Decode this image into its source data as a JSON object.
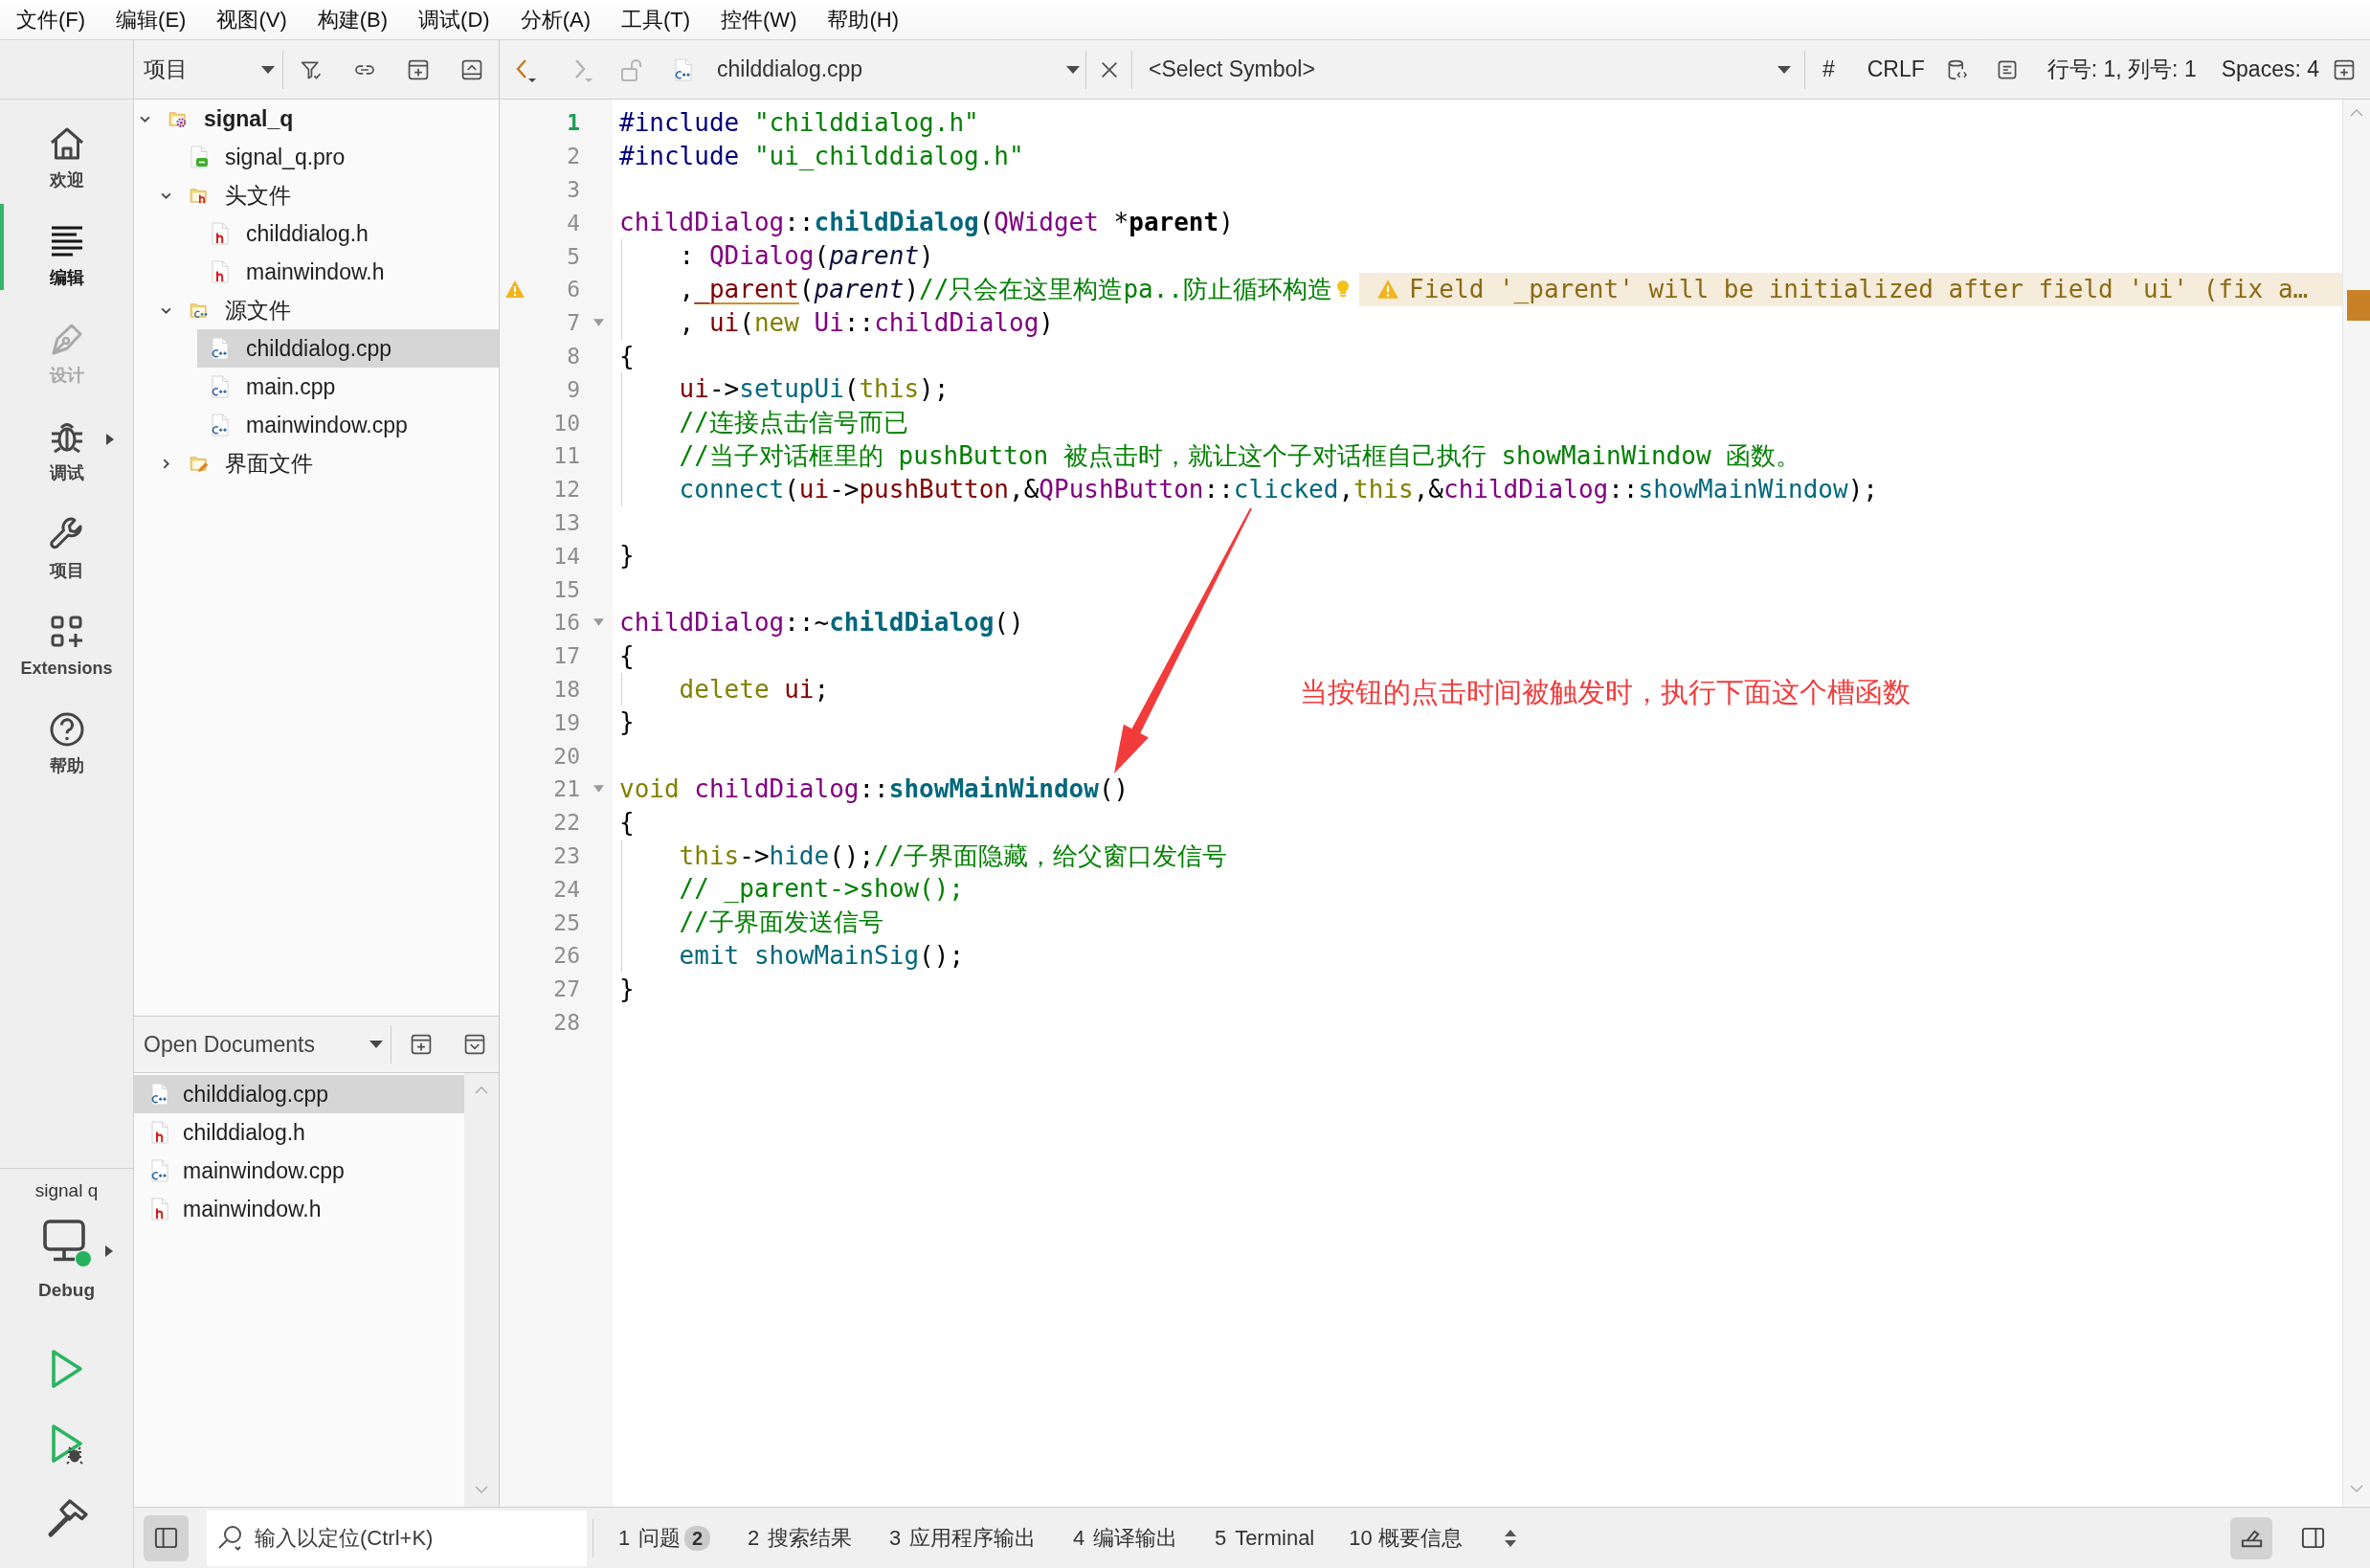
{
  "menu_bar": [
    "文件(F)",
    "编辑(E)",
    "视图(V)",
    "构建(B)",
    "调试(D)",
    "分析(A)",
    "工具(T)",
    "控件(W)",
    "帮助(H)"
  ],
  "mode_bar": {
    "modes": [
      {
        "kind": "welcome",
        "label": "欢迎",
        "selected": false,
        "disabled": false,
        "submenu": false
      },
      {
        "kind": "edit",
        "label": "编辑",
        "selected": true,
        "disabled": false,
        "submenu": false
      },
      {
        "kind": "design",
        "label": "设计",
        "selected": false,
        "disabled": true,
        "submenu": false
      },
      {
        "kind": "debug",
        "label": "调试",
        "selected": false,
        "disabled": false,
        "submenu": true
      },
      {
        "kind": "projects",
        "label": "项目",
        "selected": false,
        "disabled": false,
        "submenu": false
      },
      {
        "kind": "extensions",
        "label": "Extensions",
        "selected": false,
        "disabled": false,
        "submenu": false
      },
      {
        "kind": "help",
        "label": "帮助",
        "selected": false,
        "disabled": false,
        "submenu": false
      }
    ],
    "kit": {
      "project": "signal q",
      "build": "Debug"
    }
  },
  "project_pane": {
    "view": "项目",
    "tree": [
      {
        "name": "signal_q",
        "kind": "project",
        "expanded": true,
        "selected": false,
        "children": [
          {
            "name": "signal_q.pro",
            "kind": "profile",
            "selected": false
          },
          {
            "name": "头文件",
            "kind": "headers",
            "expanded": true,
            "selected": false,
            "children": [
              {
                "name": "childdialog.h",
                "kind": "header",
                "selected": false
              },
              {
                "name": "mainwindow.h",
                "kind": "header",
                "selected": false
              }
            ]
          },
          {
            "name": "源文件",
            "kind": "sources",
            "expanded": true,
            "selected": false,
            "children": [
              {
                "name": "childdialog.cpp",
                "kind": "source",
                "selected": true
              },
              {
                "name": "main.cpp",
                "kind": "source",
                "selected": false
              },
              {
                "name": "mainwindow.cpp",
                "kind": "source",
                "selected": false
              }
            ]
          },
          {
            "name": "界面文件",
            "kind": "forms",
            "expanded": false,
            "selected": false
          }
        ]
      }
    ]
  },
  "open_documents": {
    "view": "Open Documents",
    "items": [
      {
        "name": "childdialog.cpp",
        "kind": "source",
        "selected": true
      },
      {
        "name": "childdialog.h",
        "kind": "header",
        "selected": false
      },
      {
        "name": "mainwindow.cpp",
        "kind": "source",
        "selected": false
      },
      {
        "name": "mainwindow.h",
        "kind": "header",
        "selected": false
      }
    ]
  },
  "editor_toolbar": {
    "navigation": [
      {
        "kind": "back",
        "disabled": false
      },
      {
        "kind": "forward",
        "disabled": true
      }
    ],
    "file": {
      "name": "childdialog.cpp",
      "kind": "source"
    },
    "symbol": "<Select Symbol>",
    "hash": "#",
    "line_ending": "CRLF",
    "position": "行号: 1, 列号: 1",
    "indentation": "Spaces: 4"
  },
  "editor": {
    "lines": [
      {
        "number": "1",
        "current": true,
        "fold": false,
        "tokens": [
          {
            "text": "#include ",
            "kind": "preproc"
          },
          {
            "text": "\"childdialog.h\"",
            "kind": "string"
          }
        ]
      },
      {
        "number": "2",
        "current": false,
        "fold": false,
        "tokens": [
          {
            "text": "#include ",
            "kind": "preproc"
          },
          {
            "text": "\"ui_childdialog.h\"",
            "kind": "string"
          }
        ]
      },
      {
        "number": "3",
        "current": false,
        "fold": false
      },
      {
        "number": "4",
        "current": false,
        "fold": false,
        "tokens": [
          {
            "text": "childDialog",
            "kind": "type"
          },
          {
            "text": "::",
            "kind": "plain"
          },
          {
            "text": "childDialog",
            "kind": "decl"
          },
          {
            "text": "(",
            "kind": "plain"
          },
          {
            "text": "QWidget",
            "kind": "type"
          },
          {
            "text": " *",
            "kind": "plain"
          },
          {
            "text": "parent",
            "kind": "paramdecl"
          },
          {
            "text": ")",
            "kind": "plain"
          }
        ]
      },
      {
        "number": "5",
        "current": false,
        "fold": false,
        "tokens": [
          {
            "text": "    : ",
            "kind": "plain"
          },
          {
            "text": "QDialog",
            "kind": "type"
          },
          {
            "text": "(",
            "kind": "plain"
          },
          {
            "text": "parent",
            "kind": "param"
          },
          {
            "text": ")",
            "kind": "plain"
          }
        ]
      },
      {
        "number": "6",
        "current": false,
        "fold": false,
        "tokens": [
          {
            "text": "    ,",
            "kind": "plain"
          },
          {
            "text": "_parent",
            "kind": "flagged"
          },
          {
            "text": "(",
            "kind": "plain"
          },
          {
            "text": "parent",
            "kind": "param"
          },
          {
            "text": ")",
            "kind": "plain"
          },
          {
            "text": "//只会在这里构造pa..防止循环构造",
            "kind": "comment"
          }
        ],
        "diagnostic": {
          "message": "Field '_parent' will be initialized after field 'ui' (fix a…"
        }
      },
      {
        "number": "7",
        "current": false,
        "fold": true,
        "tokens": [
          {
            "text": "    , ",
            "kind": "plain"
          },
          {
            "text": "ui",
            "kind": "member"
          },
          {
            "text": "(",
            "kind": "plain"
          },
          {
            "text": "new ",
            "kind": "keyword"
          },
          {
            "text": "Ui",
            "kind": "type"
          },
          {
            "text": "::",
            "kind": "plain"
          },
          {
            "text": "childDialog",
            "kind": "type"
          },
          {
            "text": ")",
            "kind": "plain"
          }
        ]
      },
      {
        "number": "8",
        "current": false,
        "fold": false,
        "tokens": [
          {
            "text": "{",
            "kind": "plain"
          }
        ]
      },
      {
        "number": "9",
        "current": false,
        "fold": false,
        "tokens": [
          {
            "text": "    ui",
            "kind": "member"
          },
          {
            "text": "->",
            "kind": "plain"
          },
          {
            "text": "setupUi",
            "kind": "func"
          },
          {
            "text": "(",
            "kind": "plain"
          },
          {
            "text": "this",
            "kind": "keyword"
          },
          {
            "text": ");",
            "kind": "plain"
          }
        ]
      },
      {
        "number": "10",
        "current": false,
        "fold": false,
        "tokens": [
          {
            "text": "    //连接点击信号而已",
            "kind": "comment"
          }
        ]
      },
      {
        "number": "11",
        "current": false,
        "fold": false,
        "tokens": [
          {
            "text": "    //当子对话框里的 pushButton 被点击时，就让这个子对话框自己执行 showMainWindow 函数。",
            "kind": "comment"
          }
        ]
      },
      {
        "number": "12",
        "current": false,
        "fold": false,
        "tokens": [
          {
            "text": "    connect",
            "kind": "func"
          },
          {
            "text": "(",
            "kind": "plain"
          },
          {
            "text": "ui",
            "kind": "member"
          },
          {
            "text": "->",
            "kind": "plain"
          },
          {
            "text": "pushButton",
            "kind": "member"
          },
          {
            "text": ",&",
            "kind": "plain"
          },
          {
            "text": "QPushButton",
            "kind": "type"
          },
          {
            "text": "::",
            "kind": "plain"
          },
          {
            "text": "clicked",
            "kind": "func"
          },
          {
            "text": ",",
            "kind": "plain"
          },
          {
            "text": "this",
            "kind": "keyword"
          },
          {
            "text": ",&",
            "kind": "plain"
          },
          {
            "text": "childDialog",
            "kind": "type"
          },
          {
            "text": "::",
            "kind": "plain"
          },
          {
            "text": "showMainWindow",
            "kind": "func"
          },
          {
            "text": ");",
            "kind": "plain"
          }
        ]
      },
      {
        "number": "13",
        "current": false,
        "fold": false
      },
      {
        "number": "14",
        "current": false,
        "fold": false,
        "tokens": [
          {
            "text": "}",
            "kind": "plain"
          }
        ]
      },
      {
        "number": "15",
        "current": false,
        "fold": false
      },
      {
        "number": "16",
        "current": false,
        "fold": true,
        "tokens": [
          {
            "text": "childDialog",
            "kind": "type"
          },
          {
            "text": "::~",
            "kind": "plain"
          },
          {
            "text": "childDialog",
            "kind": "decl"
          },
          {
            "text": "()",
            "kind": "plain"
          }
        ]
      },
      {
        "number": "17",
        "current": false,
        "fold": false,
        "tokens": [
          {
            "text": "{",
            "kind": "plain"
          }
        ]
      },
      {
        "number": "18",
        "current": false,
        "fold": false,
        "tokens": [
          {
            "text": "    delete ",
            "kind": "keyword"
          },
          {
            "text": "ui",
            "kind": "member"
          },
          {
            "text": ";",
            "kind": "plain"
          }
        ]
      },
      {
        "number": "19",
        "current": false,
        "fold": false,
        "tokens": [
          {
            "text": "}",
            "kind": "plain"
          }
        ]
      },
      {
        "number": "20",
        "current": false,
        "fold": false
      },
      {
        "number": "21",
        "current": false,
        "fold": true,
        "tokens": [
          {
            "text": "void ",
            "kind": "keyword"
          },
          {
            "text": "childDialog",
            "kind": "type"
          },
          {
            "text": "::",
            "kind": "plain"
          },
          {
            "text": "showMainWindow",
            "kind": "decl"
          },
          {
            "text": "()",
            "kind": "plain"
          }
        ]
      },
      {
        "number": "22",
        "current": false,
        "fold": false,
        "tokens": [
          {
            "text": "{",
            "kind": "plain"
          }
        ]
      },
      {
        "number": "23",
        "current": false,
        "fold": false,
        "tokens": [
          {
            "text": "    this",
            "kind": "keyword"
          },
          {
            "text": "->",
            "kind": "plain"
          },
          {
            "text": "hide",
            "kind": "func"
          },
          {
            "text": "();",
            "kind": "plain"
          },
          {
            "text": "//子界面隐藏，给父窗口发信号",
            "kind": "comment"
          }
        ]
      },
      {
        "number": "24",
        "current": false,
        "fold": false,
        "tokens": [
          {
            "text": "    // _parent->show();",
            "kind": "comment"
          }
        ]
      },
      {
        "number": "25",
        "current": false,
        "fold": false,
        "tokens": [
          {
            "text": "    //子界面发送信号",
            "kind": "comment"
          }
        ]
      },
      {
        "number": "26",
        "current": false,
        "fold": false,
        "tokens": [
          {
            "text": "    emit ",
            "kind": "macro"
          },
          {
            "text": "showMainSig",
            "kind": "func"
          },
          {
            "text": "();",
            "kind": "plain"
          }
        ]
      },
      {
        "number": "27",
        "current": false,
        "fold": false,
        "tokens": [
          {
            "text": "}",
            "kind": "plain"
          }
        ]
      },
      {
        "number": "28",
        "current": false,
        "fold": false
      }
    ],
    "annotation": {
      "text": "当按钮的点击时间被触发时，执行下面这个槽函数"
    }
  },
  "status_bar": {
    "sidebar_toggle": {
      "on": true
    },
    "locator": {
      "placeholder": "输入以定位(Ctrl+K)"
    },
    "output_panes": [
      {
        "number": "1",
        "label": "问题",
        "badge": "2"
      },
      {
        "number": "2",
        "label": "搜索结果"
      },
      {
        "number": "3",
        "label": "应用程序输出"
      },
      {
        "number": "4",
        "label": "编译输出"
      },
      {
        "number": "5",
        "label": "Terminal"
      },
      {
        "number": "10",
        "label": "概要信息"
      }
    ],
    "output_toggle": {
      "on": true
    },
    "right_sidebar_toggle": {
      "on": false
    }
  }
}
